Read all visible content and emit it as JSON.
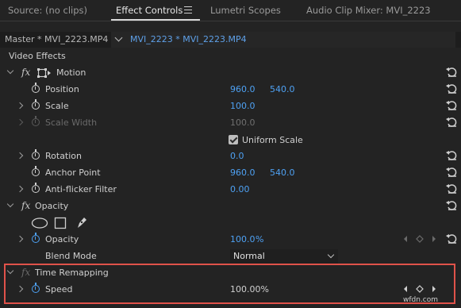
{
  "panel_tabs": [
    {
      "label": "Source: (no clips)"
    },
    {
      "label": "Effect Controls"
    },
    {
      "label": "Lumetri Scopes"
    },
    {
      "label": "Audio Clip Mixer: MVI_2223"
    }
  ],
  "clip_header": {
    "master": "Master * MVI_2223.MP4",
    "clip": "MVI_2223 * MVI_2223.MP4"
  },
  "section_label": "Video Effects",
  "fx_symbol": "fx",
  "motion": {
    "title": "Motion",
    "position": {
      "label": "Position",
      "x": "960.0",
      "y": "540.0"
    },
    "scale": {
      "label": "Scale",
      "value": "100.0"
    },
    "scale_width": {
      "label": "Scale Width",
      "value": "100.0"
    },
    "uniform_scale": {
      "label": "Uniform Scale",
      "checked": true
    },
    "rotation": {
      "label": "Rotation",
      "value": "0.0"
    },
    "anchor_point": {
      "label": "Anchor Point",
      "x": "960.0",
      "y": "540.0"
    },
    "anti_flicker": {
      "label": "Anti-flicker Filter",
      "value": "0.00"
    }
  },
  "opacity": {
    "title": "Opacity",
    "opacity_param": {
      "label": "Opacity",
      "value": "100.0",
      "unit": "%"
    },
    "blend_mode": {
      "label": "Blend Mode",
      "value": "Normal"
    }
  },
  "time_remapping": {
    "title": "Time Remapping",
    "speed": {
      "label": "Speed",
      "value": "100.00%"
    }
  },
  "colors": {
    "accent_blue": "#4ea1f3",
    "highlight_red": "#e0524a",
    "panel_bg": "#232323"
  },
  "watermark": "wfdn.com"
}
